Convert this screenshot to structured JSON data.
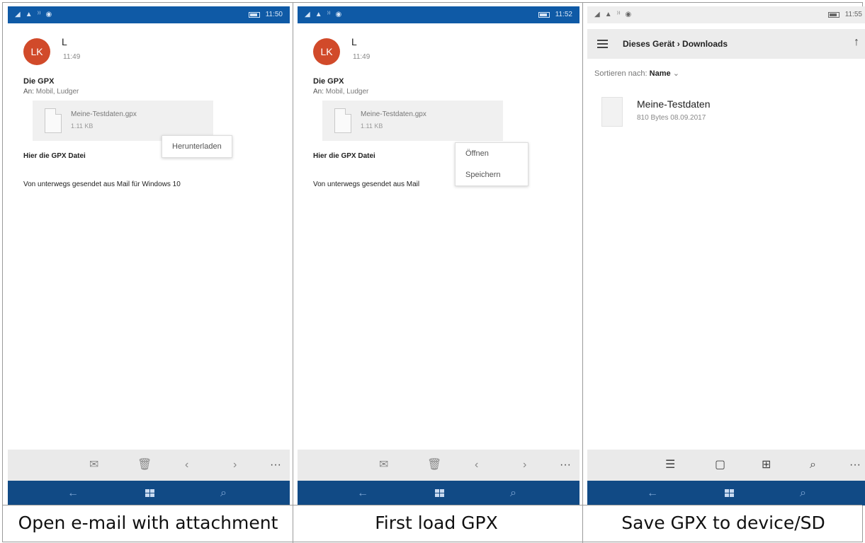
{
  "captions": [
    "Open e-mail with attachment",
    "First load GPX",
    "Save GPX to device/SD"
  ],
  "statusbars": [
    {
      "time": "11:50"
    },
    {
      "time": "11:52"
    },
    {
      "time": "11:55"
    }
  ],
  "email": {
    "avatar_initials": "LK",
    "sender": "L",
    "time": "11:49",
    "subject": "Die GPX",
    "to_label": "An:",
    "to_value": "Mobil, Ludger",
    "attachment_name": "Meine-Testdaten.gpx",
    "attachment_size": "1.11 KB",
    "body_line1": "Hier die GPX Datei",
    "body_line2": "Von unterwegs gesendet aus Mail für Windows 10",
    "body_line2_truncated": "Von unterwegs gesendet aus Mail"
  },
  "download_menu": {
    "download": "Herunterladen"
  },
  "open_menu": {
    "open": "Öffnen",
    "save": "Speichern"
  },
  "explorer": {
    "breadcrumb": "Dieses Gerät › Downloads",
    "sort_label": "Sortieren nach:",
    "sort_value": "Name",
    "file_name": "Meine-Testdaten",
    "file_meta": "810 Bytes 08.09.2017"
  },
  "icons": {
    "mail_appbar": [
      "reply-icon",
      "delete-icon",
      "previous-icon",
      "next-icon",
      "more-icon"
    ],
    "explorer_appbar": [
      "select-icon",
      "new-folder-icon",
      "view-icon",
      "search-icon",
      "more-icon"
    ],
    "navbar": [
      "back-icon",
      "windows-icon",
      "search-icon"
    ]
  },
  "colors": {
    "statusbar": "#0f5aa6",
    "navbar": "#114a85",
    "avatar": "#d14a2a"
  }
}
